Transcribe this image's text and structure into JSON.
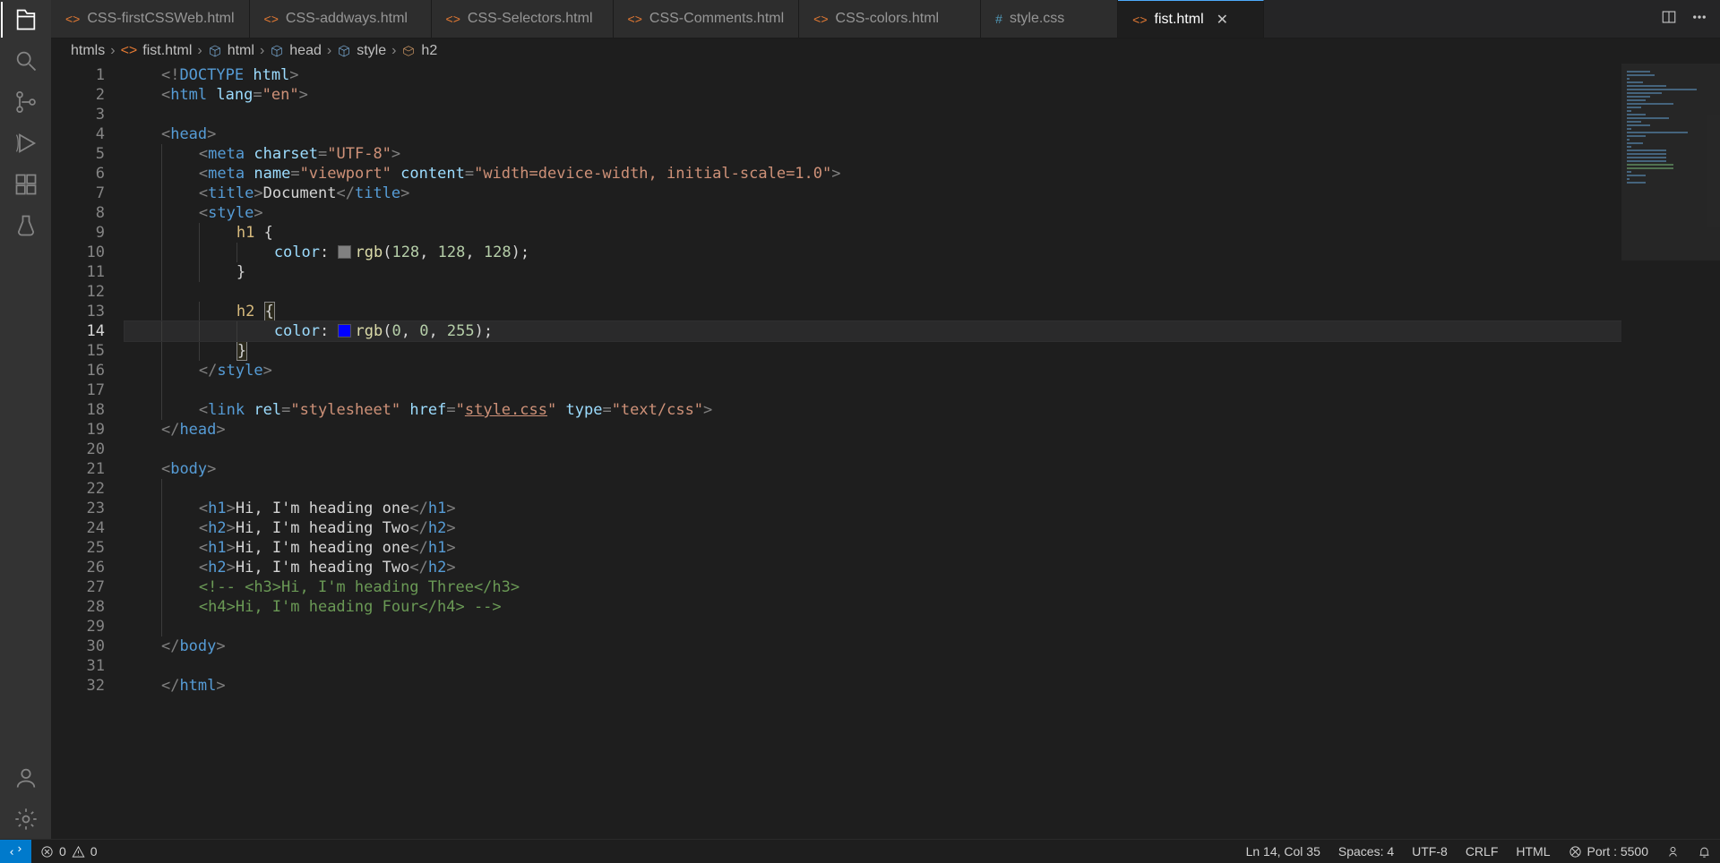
{
  "tabs": [
    {
      "label": "CSS-firstCSSWeb.html",
      "icon": "html",
      "active": false
    },
    {
      "label": "CSS-addways.html",
      "icon": "html",
      "active": false
    },
    {
      "label": "CSS-Selectors.html",
      "icon": "html",
      "active": false
    },
    {
      "label": "CSS-Comments.html",
      "icon": "html",
      "active": false
    },
    {
      "label": "CSS-colors.html",
      "icon": "html",
      "active": false
    },
    {
      "label": "style.css",
      "icon": "hash",
      "active": false
    },
    {
      "label": "fist.html",
      "icon": "html",
      "active": true
    }
  ],
  "breadcrumb": [
    {
      "label": "htmls",
      "icon": null
    },
    {
      "label": "fist.html",
      "icon": "html"
    },
    {
      "label": "html",
      "icon": "cube"
    },
    {
      "label": "head",
      "icon": "cube"
    },
    {
      "label": "style",
      "icon": "cube"
    },
    {
      "label": "h2",
      "icon": "field"
    }
  ],
  "activity": {
    "explorer": "Explorer",
    "search": "Search",
    "scm": "Source Control",
    "debug": "Run and Debug",
    "extensions": "Extensions",
    "testing": "Testing",
    "accounts": "Accounts",
    "settings": "Manage"
  },
  "code": {
    "lines_total": 32,
    "current_line": 14,
    "file": {
      "doctype": "<!DOCTYPE html>",
      "html_open_attr": "lang",
      "html_open_val": "en",
      "meta1_attr": "charset",
      "meta1_val": "UTF-8",
      "meta2_attr1": "name",
      "meta2_val1": "viewport",
      "meta2_attr2": "content",
      "meta2_val2": "width=device-width, initial-scale=1.0",
      "title_text": "Document",
      "h1_color": "rgb(128, 128, 128)",
      "h1_swatch": "#808080",
      "h2_color": "rgb(0, 0, 255)",
      "h2_swatch": "#0000ff",
      "link_rel": "stylesheet",
      "link_href": "style.css",
      "link_type": "text/css",
      "body_lines": [
        {
          "tag": "h1",
          "text": "Hi, I'm heading one"
        },
        {
          "tag": "h2",
          "text": "Hi, I'm heading Two"
        },
        {
          "tag": "h1",
          "text": "Hi, I'm heading one"
        },
        {
          "tag": "h2",
          "text": "Hi, I'm heading Two"
        }
      ],
      "comment_line1": "<!-- <h3>Hi, I'm heading Three</h3>",
      "comment_line2": "<h4>Hi, I'm heading Four</h4> -->"
    }
  },
  "statusbar": {
    "errors": "0",
    "warnings": "0",
    "cursor": "Ln 14, Col 35",
    "spaces": "Spaces: 4",
    "encoding": "UTF-8",
    "eol": "CRLF",
    "language": "HTML",
    "port": "Port : 5500"
  }
}
